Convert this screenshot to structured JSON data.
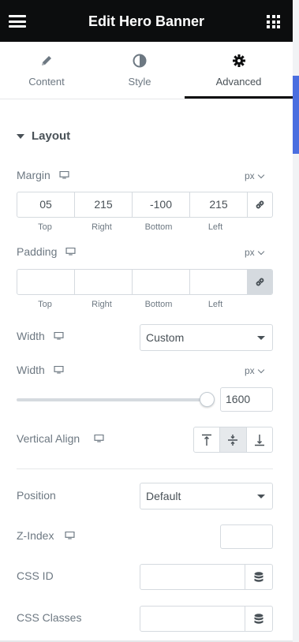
{
  "header": {
    "title": "Edit Hero Banner",
    "menu_icon": "hamburger-icon",
    "apps_icon": "grid-icon"
  },
  "tabs": [
    {
      "label": "Content",
      "icon": "pencil-icon",
      "active": false
    },
    {
      "label": "Style",
      "icon": "half-circle-icon",
      "active": false
    },
    {
      "label": "Advanced",
      "icon": "gear-icon",
      "active": true
    }
  ],
  "section": {
    "title": "Layout"
  },
  "margin": {
    "label": "Margin",
    "unit": "px",
    "values": {
      "top": "05",
      "right": "215",
      "bottom": "-100",
      "left": "215"
    },
    "sides": {
      "top": "Top",
      "right": "Right",
      "bottom": "Bottom",
      "left": "Left"
    },
    "linked": false
  },
  "padding": {
    "label": "Padding",
    "unit": "px",
    "values": {
      "top": "",
      "right": "",
      "bottom": "",
      "left": ""
    },
    "sides": {
      "top": "Top",
      "right": "Right",
      "bottom": "Bottom",
      "left": "Left"
    },
    "linked": true
  },
  "width_select": {
    "label": "Width",
    "value": "Custom"
  },
  "width_slider": {
    "label": "Width",
    "unit": "px",
    "value": "1600",
    "level": 1.0
  },
  "vertical_align": {
    "label": "Vertical Align",
    "options": [
      "top-align-icon",
      "middle-align-icon",
      "bottom-align-icon"
    ],
    "selected": 1
  },
  "position": {
    "label": "Position",
    "value": "Default"
  },
  "z_index": {
    "label": "Z-Index",
    "value": ""
  },
  "css_id": {
    "label": "CSS ID",
    "value": ""
  },
  "css_classes": {
    "label": "CSS Classes",
    "value": ""
  },
  "colors": {
    "header_bg": "#0c0d0e",
    "accent": "#4a6ee0",
    "text": "#6d7882",
    "border": "#d5dadf"
  }
}
